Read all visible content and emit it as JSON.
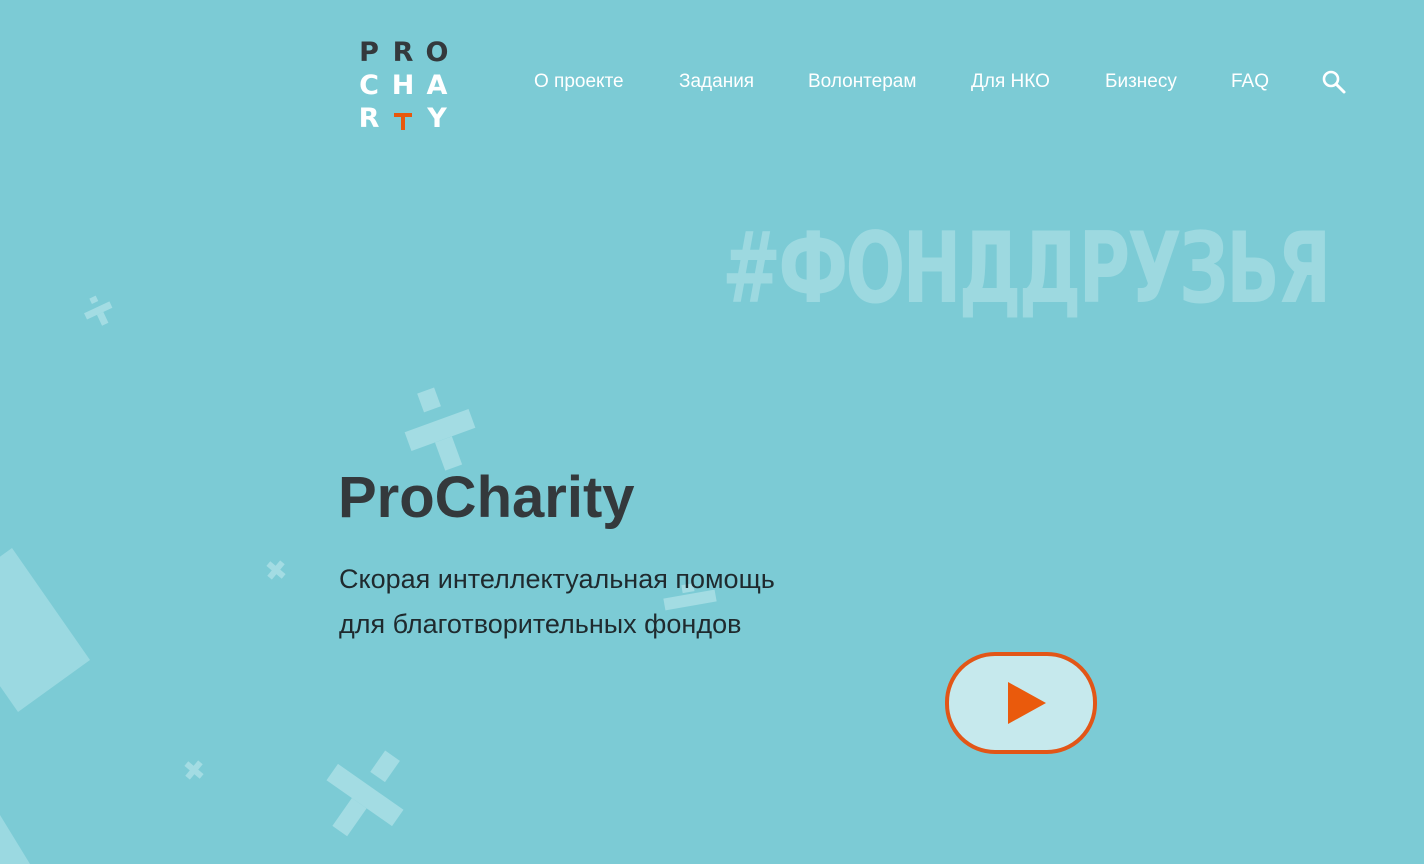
{
  "logo": {
    "row1": [
      "P",
      "R",
      "O"
    ],
    "row2": [
      "C",
      "H",
      "A"
    ],
    "row3_left": "R",
    "row3_right": "Y"
  },
  "nav": {
    "items": [
      {
        "label": "О проекте"
      },
      {
        "label": "Задания"
      },
      {
        "label": "Волонтерам"
      },
      {
        "label": "Для НКО"
      },
      {
        "label": "Бизнесу"
      },
      {
        "label": "FAQ"
      }
    ],
    "search_icon": "search-icon"
  },
  "hero": {
    "hashtag": "#ФОНДДРУЗЬЯ",
    "title": "ProCharity",
    "subtitle_line1": "Скорая интеллектуальная помощь",
    "subtitle_line2": "для благотворительных фондов",
    "play_icon": "play-icon"
  },
  "colors": {
    "background": "#7ccbd5",
    "accent": "#e8580c",
    "dark_text": "#34393c",
    "light_shape": "#a3dce3"
  }
}
